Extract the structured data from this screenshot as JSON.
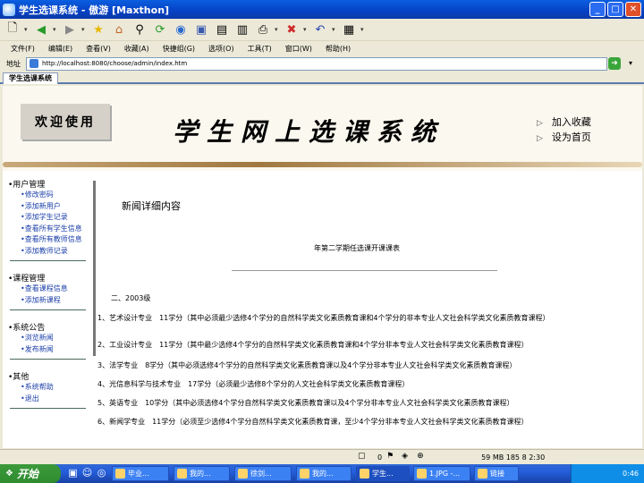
{
  "window": {
    "title": "学生选课系统 - 傲游 [Maxthon]",
    "minimize": "_",
    "maximize": "□",
    "close": "✕"
  },
  "toolbar": {
    "icons": [
      "new-page-icon",
      "back-icon",
      "forward-icon",
      "favorites-icon",
      "home-icon",
      "search-icon",
      "refresh-icon",
      "globe-icon",
      "save-icon",
      "page-icon",
      "page2-icon",
      "print-icon",
      "edit-icon",
      "stop-icon",
      "undo-icon",
      "view-icon"
    ]
  },
  "menu": {
    "items": [
      "文件(F)",
      "编辑(E)",
      "查看(V)",
      "收藏(A)",
      "快捷组(G)",
      "选项(O)",
      "工具(T)",
      "窗口(W)",
      "帮助(H)"
    ]
  },
  "address": {
    "label": "地址",
    "url": "http://localhost:8080/choose/admin/index.htm"
  },
  "tab": {
    "label": "学生选课系统"
  },
  "banner": {
    "welcome": "欢迎使用",
    "title": "学生网上选课系统",
    "add_favorite": "加入收藏",
    "set_home": "设为首页"
  },
  "sidebar": {
    "sections": [
      {
        "title": "用户管理",
        "items": [
          "修改密码",
          "添加新用户",
          "添加学生记录",
          "查看所有学生信息",
          "查看所有教师信息",
          "添加教师记录"
        ]
      },
      {
        "title": "课程管理",
        "items": [
          "查看课程信息",
          "添加新课程"
        ]
      },
      {
        "title": "系统公告",
        "items": [
          "浏览新闻",
          "发布新闻"
        ]
      },
      {
        "title": "其他",
        "items": [
          "系统帮助",
          "退出"
        ]
      }
    ]
  },
  "content": {
    "section_title": "新闻详细内容",
    "doc_title": "年第二学期任选课开课课表",
    "grade": "二、2003级",
    "paragraphs": [
      "1、艺术设计专业　11学分（其中必须最少选修4个学分的自然科学类文化素质教育课和4个学分的非本专业人文社会科学类文化素质教育课程）",
      "2、工业设计专业　11学分（其中最少选修4个学分的自然科学类文化素质教育课和4个学分非本专业人文社会科学类文化素质教育课程）",
      "3、法学专业　8学分（其中必须选修4个学分的自然科学类文化素质教育课以及4个学分非本专业人文社会科学类文化素质教育课程）",
      "4、光信息科学与技术专业　17学分（必须最少选修8个学分的人文社会科学类文化素质教育课程）",
      "5、英语专业　10学分（其中必须选修4个学分自然科学类文化素质教育课以及4个学分非本专业人文社会科学类文化素质教育课程）",
      "6、新闻学专业　11学分（必须至少选修4个学分自然科学类文化素质教育课，至少4个学分非本专业人文社会科学类文化素质教育课程）"
    ]
  },
  "statusbar": {
    "text": "0",
    "right": "59 MB 185 8 2:30"
  },
  "taskbar": {
    "start": "开始",
    "tasks": [
      "毕业...",
      "我的...",
      "徐剑...",
      "我的...",
      "学生...",
      "1.JPG -...",
      "链接"
    ],
    "time": "0:46"
  }
}
